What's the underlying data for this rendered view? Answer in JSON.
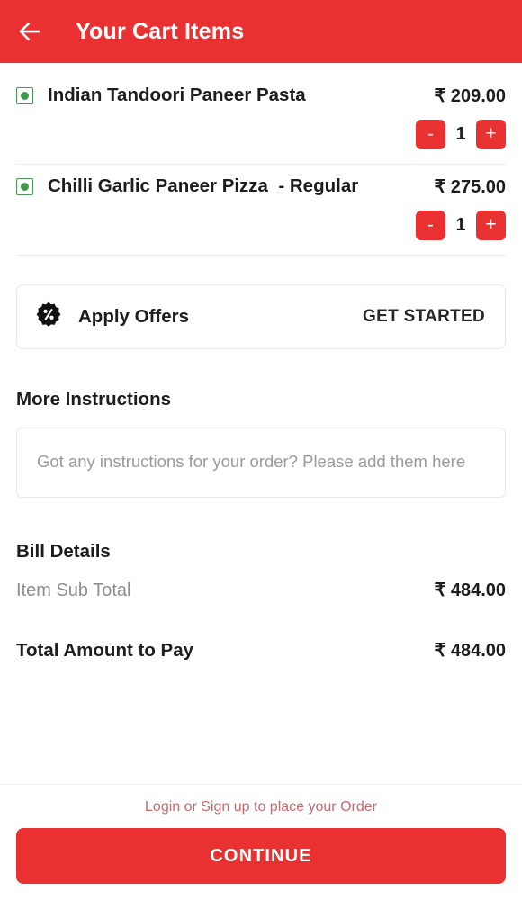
{
  "header": {
    "title": "Your Cart Items",
    "back_icon": "arrow-left-icon",
    "background_color": "#ea3131"
  },
  "cart": {
    "items": [
      {
        "veg_indicator": "veg-dot-icon",
        "name": "Indian Tandoori Paneer Pasta",
        "price": "₹ 209.00",
        "quantity": "1",
        "decrement_label": "-",
        "increment_label": "+"
      },
      {
        "veg_indicator": "veg-dot-icon",
        "name": "Chilli Garlic Paneer Pizza  - Regular",
        "price": "₹ 275.00",
        "quantity": "1",
        "decrement_label": "-",
        "increment_label": "+"
      }
    ]
  },
  "offers": {
    "icon": "discount-badge-icon",
    "label": "Apply Offers",
    "cta": "GET STARTED"
  },
  "instructions": {
    "title": "More Instructions",
    "placeholder": "Got any instructions for your order? Please add them here",
    "value": ""
  },
  "bill": {
    "title": "Bill Details",
    "subtotal_label": "Item Sub Total",
    "subtotal_value": "₹ 484.00",
    "total_label": "Total Amount to Pay",
    "total_value": "₹ 484.00"
  },
  "footer": {
    "login_hint": "Login or Sign up to place your Order",
    "continue_label": "CONTINUE",
    "accent_color": "#ea3131",
    "hint_color": "#c9696e"
  }
}
